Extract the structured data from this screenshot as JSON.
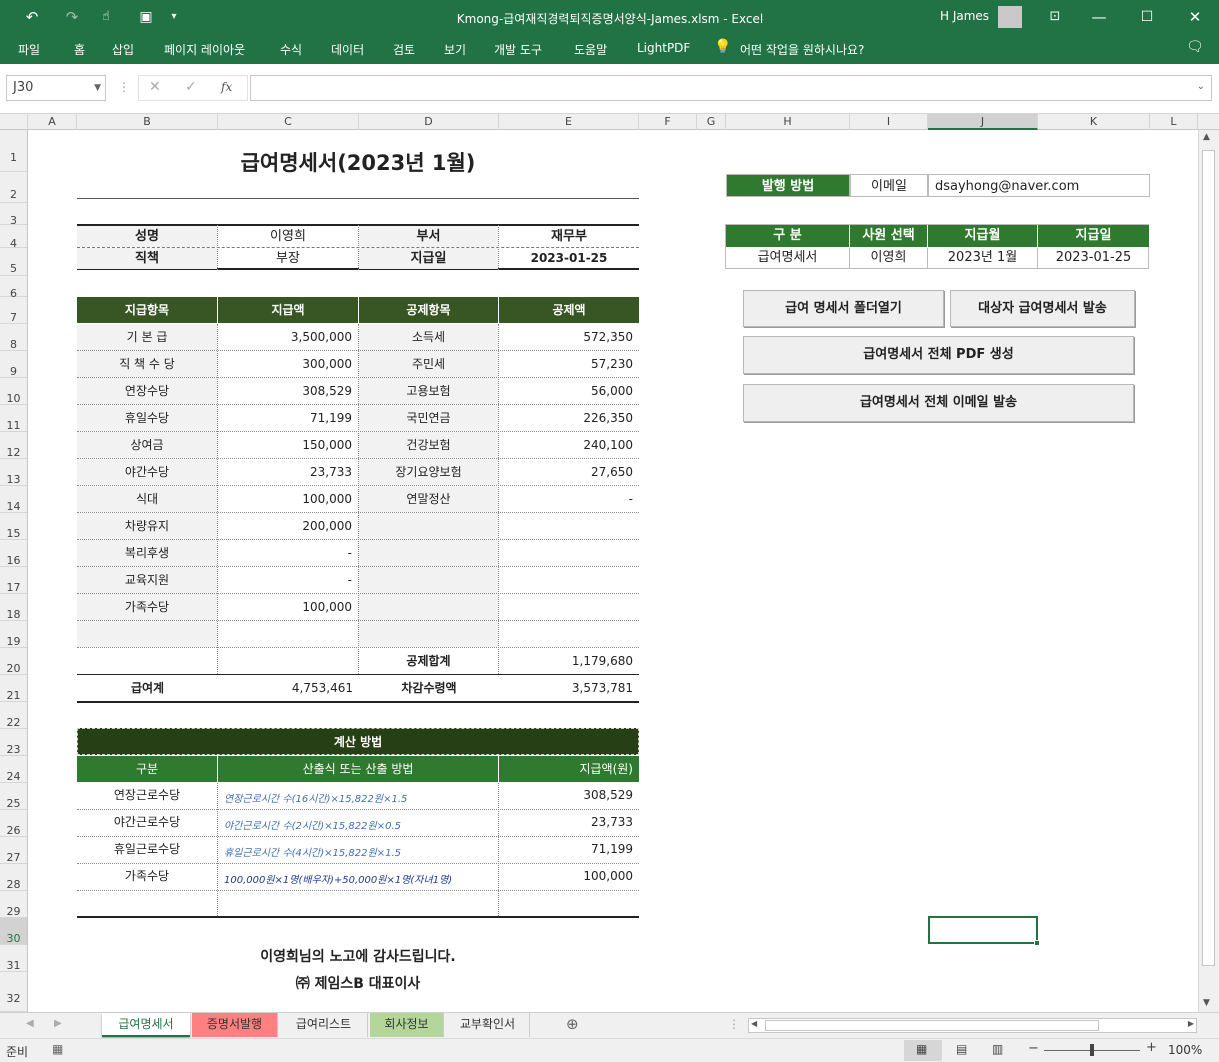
{
  "window": {
    "title": "Kmong-급여재직경력퇴직증명서양식-James.xlsm  -  Excel",
    "user": "H James"
  },
  "ribbon": {
    "tabs": [
      "파일",
      "홈",
      "삽입",
      "페이지 레이아웃",
      "수식",
      "데이터",
      "검토",
      "보기",
      "개발 도구",
      "도움말",
      "LightPDF"
    ],
    "tellme": "어떤 작업을 원하시나요?"
  },
  "formula": {
    "namebox": "J30",
    "fx": "fx",
    "value": ""
  },
  "columns": [
    "A",
    "B",
    "C",
    "D",
    "E",
    "F",
    "G",
    "H",
    "I",
    "J",
    "K",
    "L"
  ],
  "rows": [
    "1",
    "2",
    "3",
    "4",
    "5",
    "6",
    "7",
    "8",
    "9",
    "10",
    "11",
    "12",
    "13",
    "14",
    "15",
    "16",
    "17",
    "18",
    "19",
    "20",
    "21",
    "22",
    "23",
    "24",
    "25",
    "26",
    "27",
    "28",
    "29",
    "30",
    "31",
    "32"
  ],
  "payslip": {
    "title": "급여명세서(2023년 1월)",
    "info": {
      "name_label": "성명",
      "name": "이영희",
      "dept_label": "부서",
      "dept": "재무부",
      "pos_label": "직책",
      "pos": "부장",
      "paydate_label": "지급일",
      "paydate": "2023-01-25"
    },
    "headers": {
      "pay_item": "지급항목",
      "pay_amt": "지급액",
      "ded_item": "공제항목",
      "ded_amt": "공제액"
    },
    "lines": [
      {
        "pi": "기  본  급",
        "pa": "3,500,000",
        "di": "소득세",
        "da": "572,350"
      },
      {
        "pi": "직 책 수 당",
        "pa": "300,000",
        "di": "주민세",
        "da": "57,230"
      },
      {
        "pi": "연장수당",
        "pa": "308,529",
        "di": "고용보험",
        "da": "56,000"
      },
      {
        "pi": "휴일수당",
        "pa": "71,199",
        "di": "국민연금",
        "da": "226,350"
      },
      {
        "pi": "상여금",
        "pa": "150,000",
        "di": "건강보험",
        "da": "240,100"
      },
      {
        "pi": "야간수당",
        "pa": "23,733",
        "di": "장기요양보험",
        "da": "27,650"
      },
      {
        "pi": "식대",
        "pa": "100,000",
        "di": "연말정산",
        "da": "-"
      },
      {
        "pi": "차량유지",
        "pa": "200,000",
        "di": "",
        "da": ""
      },
      {
        "pi": "복리후생",
        "pa": "-",
        "di": "",
        "da": ""
      },
      {
        "pi": "교육지원",
        "pa": "-",
        "di": "",
        "da": ""
      },
      {
        "pi": "가족수당",
        "pa": "100,000",
        "di": "",
        "da": ""
      },
      {
        "pi": "",
        "pa": "",
        "di": "",
        "da": ""
      }
    ],
    "ded_total_label": "공제합계",
    "ded_total": "1,179,680",
    "pay_total_label": "급여계",
    "pay_total": "4,753,461",
    "net_label": "차감수령액",
    "net": "3,573,781",
    "calc": {
      "title": "계산 방법",
      "h_type": "구분",
      "h_formula": "산출식 또는 산출 방법",
      "h_amt": "지급액(원)",
      "rows": [
        {
          "t": "연장근로수당",
          "f": "연장근로시간 수(16시간)×15,822원×1.5",
          "a": "308,529"
        },
        {
          "t": "야간근로수당",
          "f": "야간근로시간 수(2시간)×15,822원×0.5",
          "a": "23,733"
        },
        {
          "t": "휴일근로수당",
          "f": "휴일근로시간 수(4시간)×15,822원×1.5",
          "a": "71,199"
        },
        {
          "t": "가족수당",
          "f": "100,000원×1명(배우자)+50,000원×1명(자녀1명)",
          "a": "100,000"
        },
        {
          "t": "",
          "f": "",
          "a": ""
        }
      ]
    },
    "thanks": "이영희님의 노고에 감사드립니다.",
    "signer": "㈜ 제임스B 대표이사"
  },
  "control": {
    "method_label": "발행 방법",
    "method": "이메일",
    "email": "dsayhong@naver.com",
    "h_type": "구 분",
    "h_emp": "사원 선택",
    "h_month": "지급월",
    "h_date": "지급일",
    "type": "급여명세서",
    "emp": "이영희",
    "month": "2023년 1월",
    "date": "2023-01-25",
    "btn_folder": "급여 명세서 폴더열기",
    "btn_send": "대상자 급여명세서 발송",
    "btn_pdf": "급여명세서 전체 PDF 생성",
    "btn_email": "급여명세서 전체 이메일 발송"
  },
  "tabs": [
    {
      "label": "급여명세서",
      "color": "#ffffff",
      "active": true
    },
    {
      "label": "증명서발행",
      "color": "#ff8080",
      "active": false
    },
    {
      "label": "급여리스트",
      "color": "#f0f0f0",
      "active": false
    },
    {
      "label": "회사정보",
      "color": "#b3d69b",
      "active": false
    },
    {
      "label": "교부확인서",
      "color": "#f0f0f0",
      "active": false
    }
  ],
  "status": {
    "ready": "준비",
    "zoom": "100%"
  }
}
